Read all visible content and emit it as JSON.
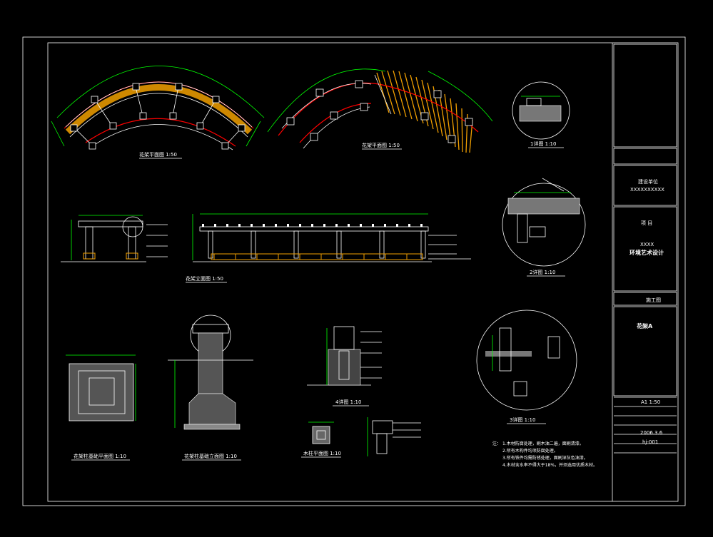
{
  "views": {
    "plan1": "花架平面图 1:50",
    "plan2": "花架平面图 1:50",
    "elevation": "花架立面图 1:50",
    "detail1": "1详图 1:10",
    "detail2": "2详图 1:10",
    "detail3": "3详图 1:10",
    "detail4": "4详图 1:10",
    "found_plan": "花架柱基础平面图 1:10",
    "found_elev": "花架柱基础立面图 1:10",
    "col_plan": "木柱平面图 1:10"
  },
  "notes": {
    "title": "注：",
    "lines": [
      "1.木材防腐处理，刷木油二遍，面刷清漆。",
      "2.所有木构件均须防腐处理。",
      "3.所有铁件均需防锈处理，面刷深灰色油漆。",
      "4.木材含水率不得大于18%，并须选用优质木材。"
    ]
  },
  "title_block": {
    "unit_label": "建设单位",
    "unit_value": "XXXXXXXXXX",
    "project_label": "项  目",
    "project_line": "XXXX",
    "project_name": "环境艺术设计",
    "stage": "施工图",
    "drawing_name": "花架A",
    "scale": "A1 1:50",
    "date": "2006.3.6",
    "drawing_no": "hj-001"
  },
  "colors": {
    "background": "#000000",
    "frame": "#ffffff",
    "dimension": "#00ff00",
    "centerline": "#ff0000",
    "timber": "#f2a000"
  }
}
